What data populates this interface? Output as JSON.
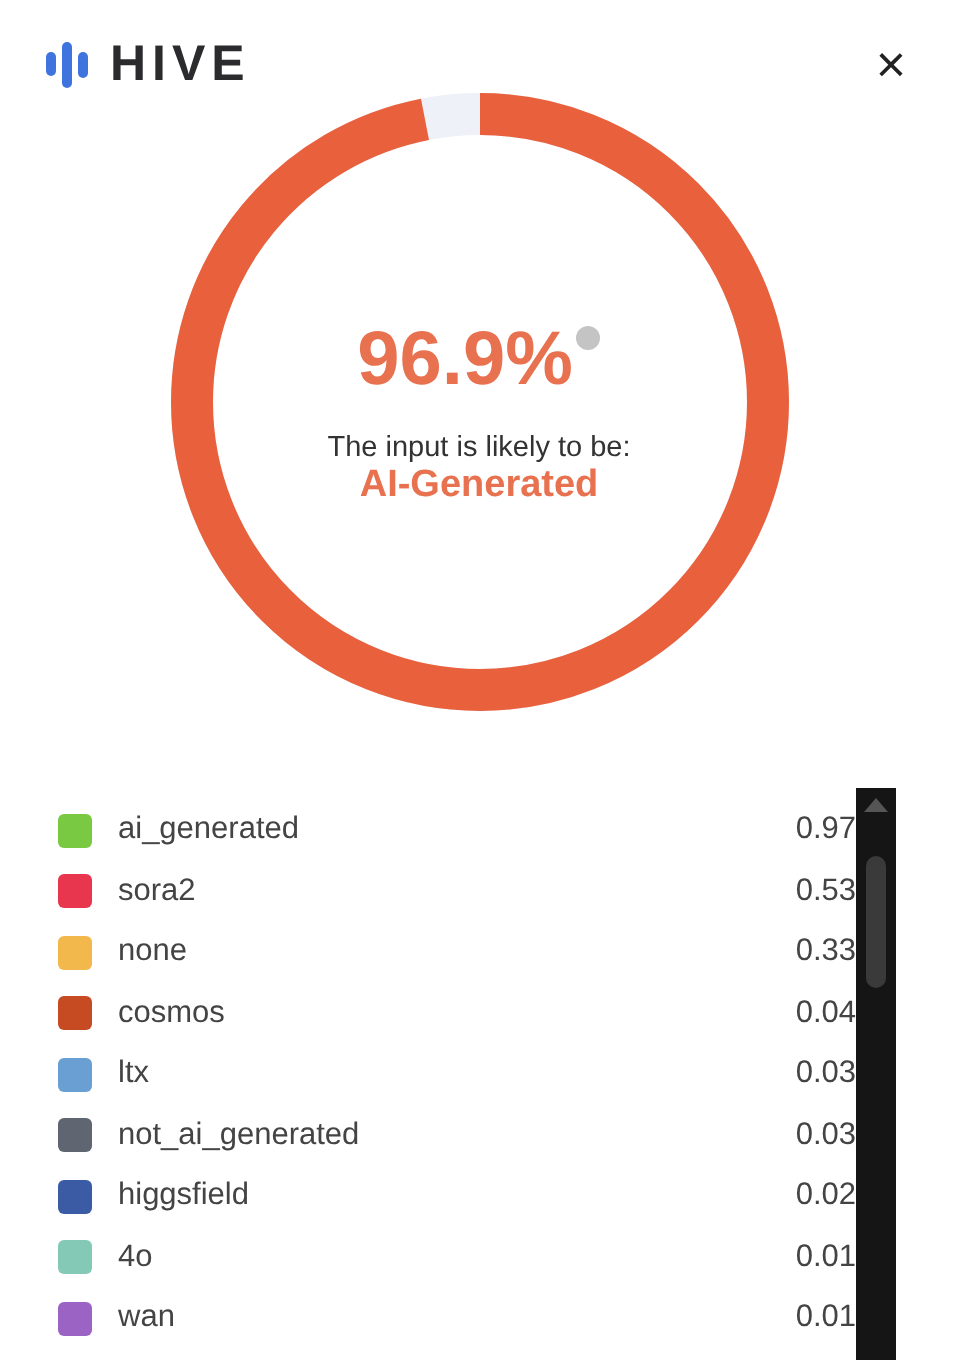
{
  "header": {
    "brand": "HIVE",
    "close": "×"
  },
  "result": {
    "percent": "96.9%",
    "caption": "The input is likely to be:",
    "verdict": "AI-Generated"
  },
  "classes": [
    {
      "name": "ai_generated",
      "value": "0.97",
      "color": "#7ac943"
    },
    {
      "name": "sora2",
      "value": "0.53",
      "color": "#e8364f"
    },
    {
      "name": "none",
      "value": "0.33",
      "color": "#f2b84b"
    },
    {
      "name": "cosmos",
      "value": "0.04",
      "color": "#c64a22"
    },
    {
      "name": "ltx",
      "value": "0.03",
      "color": "#6a9fd3"
    },
    {
      "name": "not_ai_generated",
      "value": "0.03",
      "color": "#5f6672"
    },
    {
      "name": "higgsfield",
      "value": "0.02",
      "color": "#3b5ba5"
    },
    {
      "name": "4o",
      "value": "0.01",
      "color": "#83c9b5"
    },
    {
      "name": "wan",
      "value": "0.01",
      "color": "#9b63c4"
    }
  ]
}
